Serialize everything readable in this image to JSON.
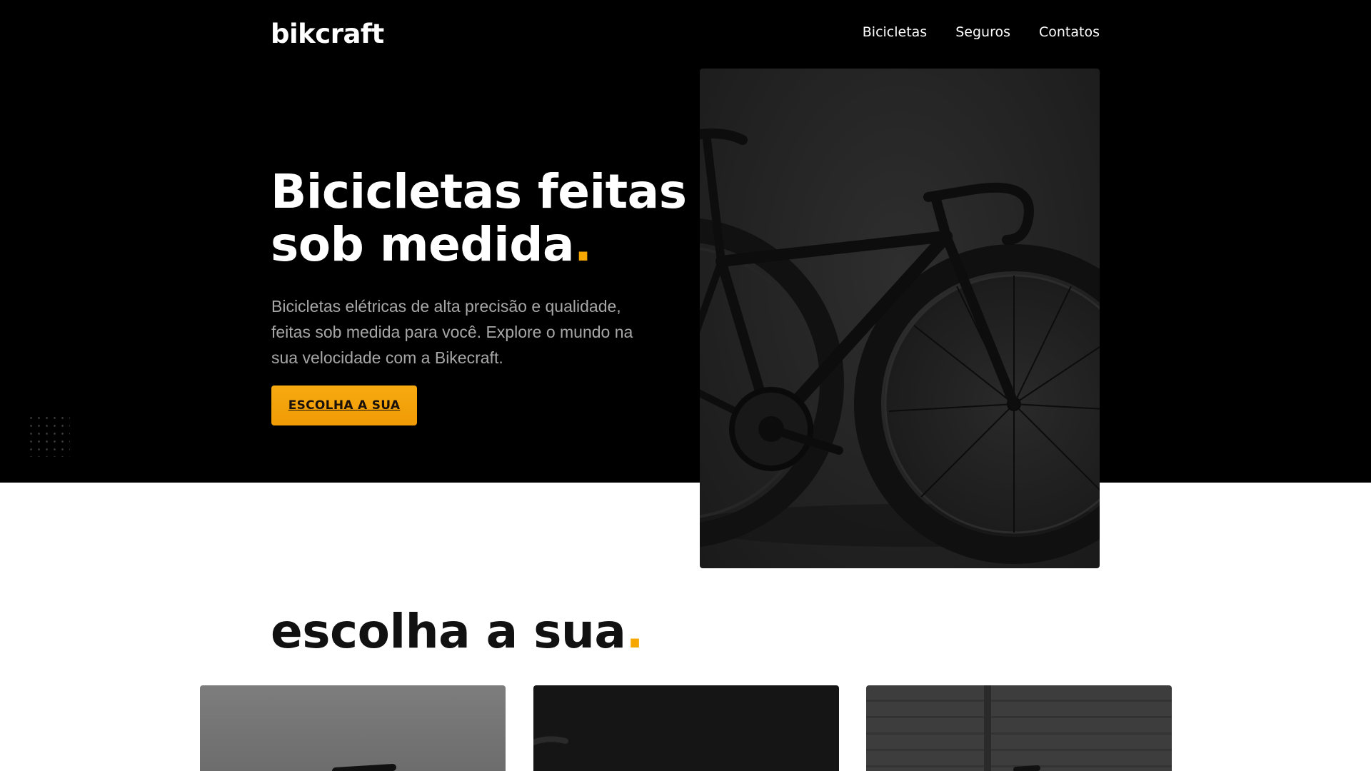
{
  "header": {
    "logo": "bikcraft",
    "nav": [
      {
        "label": "Bicicletas"
      },
      {
        "label": "Seguros"
      },
      {
        "label": "Contatos"
      }
    ]
  },
  "hero": {
    "title_line1": "Bicicletas feitas",
    "title_line2": "sob medida",
    "title_dot": ".",
    "text": "Bicicletas elétricas de alta precisão e qualidade, feitas sob medida para você. Explore o mundo na sua velocidade com a Bikecraft.",
    "cta_label": "ESCOLHA A SUA"
  },
  "products": {
    "title": "escolha a sua",
    "title_dot": "."
  },
  "colors": {
    "accent": "#f6a700",
    "hero_background": "#000000",
    "text_muted": "#a7a7a7"
  }
}
